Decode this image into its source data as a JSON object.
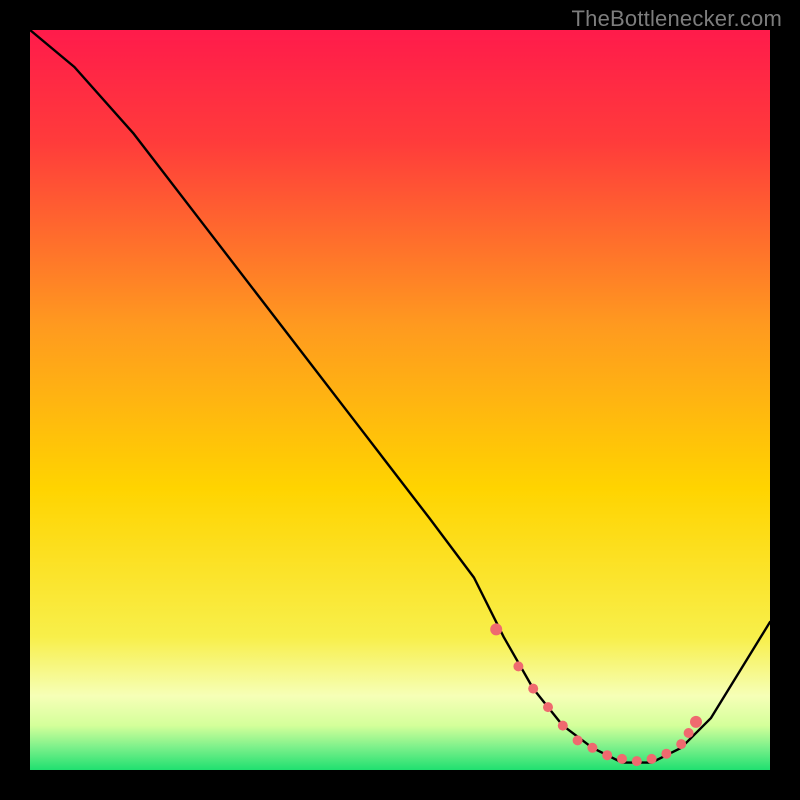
{
  "attribution": "TheBottlenecker.com",
  "colors": {
    "frame": "#000000",
    "top_gradient": "#ff1b4b",
    "mid_gradient": "#ffd400",
    "pale_band": "#f6ffb7",
    "green_band": "#20e070",
    "curve": "#000000",
    "marker": "#ef6a6f",
    "attribution": "#7d7d7d"
  },
  "chart_data": {
    "type": "line",
    "title": "",
    "xlabel": "",
    "ylabel": "",
    "xlim": [
      0,
      100
    ],
    "ylim": [
      0,
      100
    ],
    "series": [
      {
        "name": "bottleneck-curve",
        "x": [
          0,
          6,
          14,
          24,
          34,
          44,
          54,
          60,
          64,
          68,
          72,
          76,
          80,
          84,
          88,
          92,
          100
        ],
        "y": [
          100,
          95,
          86,
          73,
          60,
          47,
          34,
          26,
          18,
          11,
          6,
          3,
          1,
          1,
          3,
          7,
          20
        ]
      }
    ],
    "markers": {
      "name": "optimal-region",
      "x": [
        63,
        66,
        68,
        70,
        72,
        74,
        76,
        78,
        80,
        82,
        84,
        86,
        88,
        89,
        90
      ],
      "y": [
        19,
        14,
        11,
        8.5,
        6,
        4,
        3,
        2,
        1.5,
        1.2,
        1.5,
        2.2,
        3.5,
        5,
        6.5
      ]
    }
  }
}
